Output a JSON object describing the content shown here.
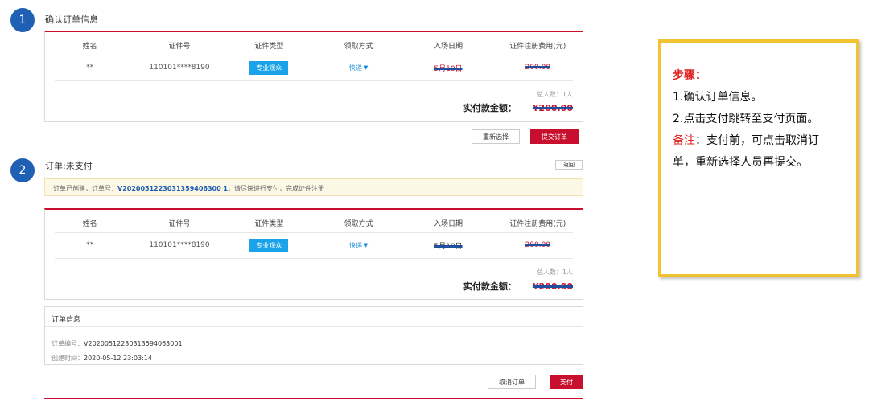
{
  "step1": {
    "number": "1",
    "title": "确认订单信息",
    "table": {
      "headers": [
        "姓名",
        "证件号",
        "证件类型",
        "领取方式",
        "入场日期",
        "证件注册费用(元)"
      ],
      "row": {
        "name": "**",
        "id_number": "110101****8190",
        "id_type": "专业观众",
        "pickup": "快递",
        "date": "5月10日",
        "fee": "200.00"
      }
    },
    "total_count": "总人数：1人",
    "paid_label": "实付款金额：",
    "paid_value": "¥200.00",
    "reselect_button": "重新选择",
    "submit_button": "提交订单"
  },
  "step2": {
    "number": "2",
    "title": "订单:未支付",
    "back_button": "返回",
    "notice": {
      "prefix": "订单已创建，订单号：",
      "order_no": "V2020051223031359406300 1",
      "suffix": "，请尽快进行支付，完成证件注册"
    },
    "table": {
      "headers": [
        "姓名",
        "证件号",
        "证件类型",
        "领取方式",
        "入场日期",
        "证件注册费用(元)"
      ],
      "row": {
        "name": "**",
        "id_number": "110101****8190",
        "id_type": "专业观众",
        "pickup": "快递",
        "date": "5月10日",
        "fee": "200.00"
      }
    },
    "total_count": "总人数：1人",
    "paid_label": "实付款金额：",
    "paid_value": "¥200.00",
    "order_info": {
      "title": "订单信息",
      "order_no_label": "订单编号：",
      "order_no": "V20200512230313594063001",
      "created_label": "创建时间：",
      "created": "2020-05-12 23:03:14"
    },
    "cancel_button": "取消订单",
    "pay_button": "支付"
  },
  "callout": {
    "steps_label": "步骤：",
    "line1": "1.确认订单信息。",
    "line2": "2.点击支付跳转至支付页面。",
    "note_label": "备注",
    "note_text_a": "：支付前，可点击取消订",
    "note_text_b": "单，重新选择人员再提交。"
  },
  "colors": {
    "brand_red": "#c8102e",
    "tag_blue": "#1aa3e8",
    "badge_blue": "#1f5fb4",
    "callout_border": "#f2c230"
  }
}
